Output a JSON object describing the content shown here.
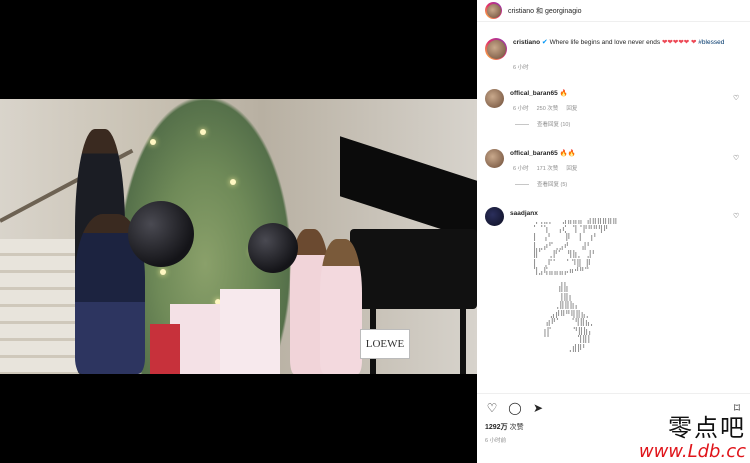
{
  "header": {
    "users": "cristiano 和 georginagio"
  },
  "caption": {
    "user": "cristiano",
    "verified": true,
    "text": "Where life begins and love never ends",
    "hearts": "❤❤❤❤❤",
    "heart2": "❤",
    "hashtag": "#blessed",
    "time": "6 小时"
  },
  "comments": [
    {
      "user": "offical_baran65",
      "text": "🔥",
      "time": "6 小时",
      "likes": "250 次赞",
      "reply": "回复",
      "view_replies": "查看回复 (10)"
    },
    {
      "user": "offical_baran65",
      "text": "🔥🔥",
      "time": "6 小时",
      "likes": "171 次赞",
      "reply": "回复",
      "view_replies": "查看回复 (5)"
    },
    {
      "user": "saadjanx",
      "ascii": "⢀⢀⣀⡀  ⣠⣤⣤⣤ ⣴⣶⣶⣶⣶⣶\n⠁⠈⢱  ⢠⢎⠀⢹⠈⡟⠛⠛⢻⠟\n⡇ ⢠⠃   ⡿  ⡇ ⢰⠃\n⣇⣀⡴⠋⢀⣠⠞   ⣼⠃\n⣿⠁ ⢀⡟⠁ ⢻⣷⡀ ⣸⠃\n⡇ ⢀⠏⠁  ⠁⠹⣿ ⡿\n⢹⣠⢯⣤⣤⣤⡤⠶⠚⠛⠉\n      ⢀⡀\n      ⣾⣷\n      ⢸⣿⡆\n     ⢀⣿⣿⣷⡄\n    ⣠⡾⠿⠛⢿⣿⣦⡀\n   ⣴⠟⠁  ⠈⢻⣿⣦⡀\n  ⢰⡏     ⠙⣿⣷⡄\n  ⠈⠁      ⢹⣿⡇\n        ⢀⣾⡿⠃"
    }
  ],
  "footer": {
    "likes_count": "1292万",
    "likes_label": "次赞",
    "time": "6 小时前"
  },
  "watermark": {
    "cn": "零点吧",
    "url": "www.Ldb.cc"
  },
  "video": {
    "gift_label": "LOEWE"
  },
  "icons": {
    "like": "heart-icon",
    "comment": "comment-icon",
    "share": "share-icon",
    "save": "bookmark-icon"
  }
}
